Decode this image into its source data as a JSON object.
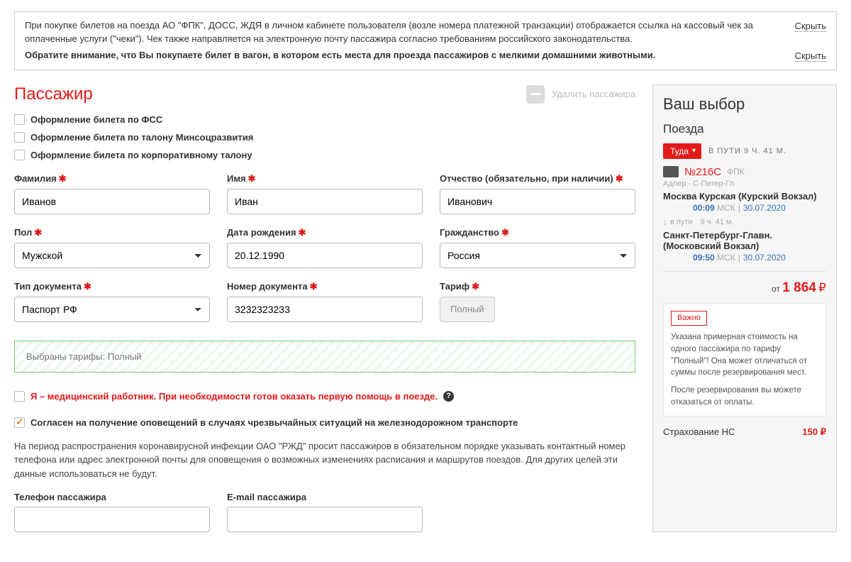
{
  "notices": {
    "n1": "При покупке билетов на поезда АО \"ФПК\", ДОСС, ЖДЯ в личном кабинете пользователя (возле номера платежной транзакции) отображается ссылка на кассовый чек за оплаченные услуги (\"чеки\"). Чек также направляется на электронную почту пассажира согласно требованиям российского законодательства.",
    "n2": "Обратите внимание, что Вы покупаете билет в вагон, в котором есть места для проезда пассажиров с мелкими домашними животными.",
    "hide": "Скрыть"
  },
  "passenger_title": "Пассажир",
  "delete_passenger": "Удалить пассажира",
  "cb_fss": "Оформление билета по ФСС",
  "cb_minsoc": "Оформление билета по талону Минсоцразвития",
  "cb_corp": "Оформление билета по корпоративному талону",
  "labels": {
    "lastname": "Фамилия",
    "firstname": "Имя",
    "patronymic": "Отчество (обязательно, при наличии)",
    "gender": "Пол",
    "dob": "Дата рождения",
    "citizenship": "Гражданство",
    "doctype": "Тип документа",
    "docnum": "Номер документа",
    "tariff": "Тариф",
    "phone": "Телефон пассажира",
    "email": "E-mail пассажира"
  },
  "values": {
    "lastname": "Иванов",
    "firstname": "Иван",
    "patronymic": "Иванович",
    "gender": "Мужской",
    "dob": "20.12.1990",
    "citizenship": "Россия",
    "doctype": "Паспорт РФ",
    "docnum": "3232323233"
  },
  "tariff_btn": "Полный",
  "tariff_bar": "Выбраны тарифы: Полный",
  "med_cb": "Я – медицинский работник. При необходимости готов оказать первую помощь в поезде.",
  "consent_cb": "Согласен на получение оповещений в случаях чрезвычайных ситуаций на железнодорожном транспорте",
  "note_para": "На период распространения коронавирусной инфекции ОАО \"РЖД\" просит пассажиров в обязательном порядке указывать контактный номер телефона или адрес электронной почты для оповещения о возможных изменениях расписания и маршрутов поездов. Для других целей эти данные использоваться не будут.",
  "side": {
    "title": "Ваш выбор",
    "section": "Поезда",
    "dir": "Туда",
    "travel": "В ПУТИ 9 Ч. 41 М.",
    "train_no": "№216С",
    "carrier": "ФПК",
    "route": "Адлер - С-Петер-Гл",
    "dep_station": "Москва Курская (Курский Вокзал)",
    "dep_time": "00:09",
    "dep_tz": "МСК",
    "dep_date": "30.07.2020",
    "inpath_l": "в пути",
    "inpath_t": "9 ч. 41 м.",
    "arr_station": "Санкт-Петербург-Главн. (Московский Вокзал)",
    "arr_time": "09:50",
    "arr_tz": "МСК",
    "arr_date": "30.07.2020",
    "price_from": "от",
    "price": "1 864",
    "rub": "₽",
    "imp": "Важно",
    "imp_p1": "Указана примерная стоимость на одного пассажира по тарифу \"Полный\"! Она может отличаться от суммы после резервирования мест.",
    "imp_p2": "После резервирования вы можете отказаться от оплаты.",
    "insure": "Страхование НС",
    "insure_price": "150 ₽"
  }
}
